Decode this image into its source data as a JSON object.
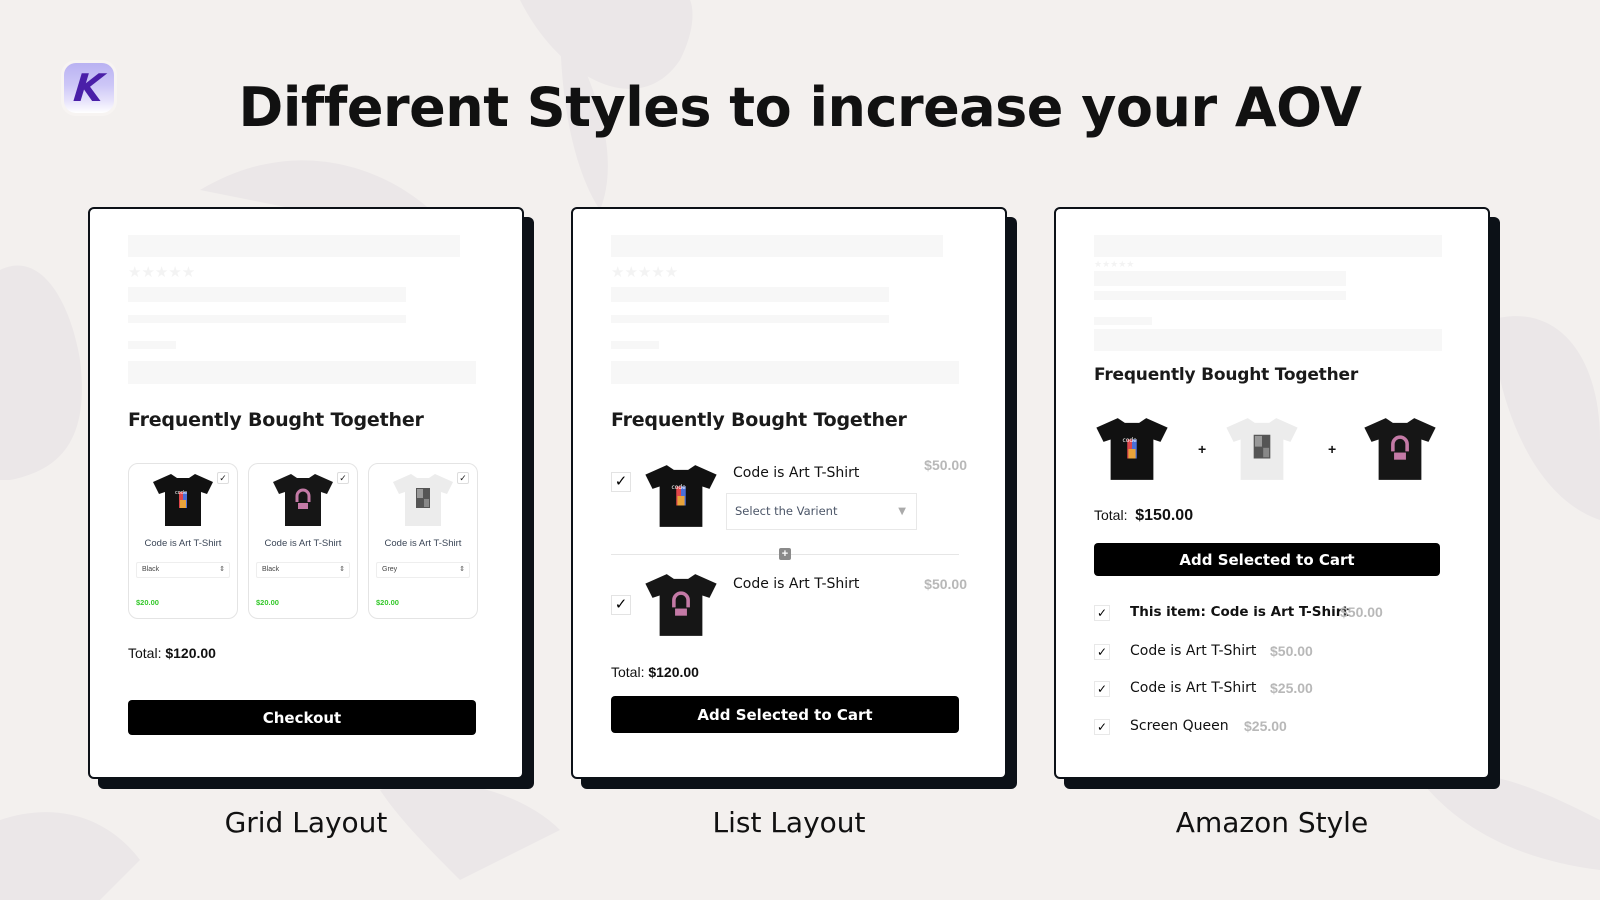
{
  "headline": "Different Styles to increase your AOV",
  "logo": {
    "letter": "K",
    "icon": "brand-logo-icon"
  },
  "colors": {
    "background": "#f3f0ee",
    "card_shadow": "#0c1117",
    "price_green": "#35c82b",
    "price_grey": "#b8b8b8",
    "logo_purple": "#4a1fa8"
  },
  "panels": {
    "grid": {
      "caption": "Grid Layout",
      "fbt_title": "Frequently Bought Together",
      "products": [
        {
          "name": "Code is Art T-Shirt",
          "variant": "Black",
          "price": "$20.00",
          "checked": true,
          "image": "black-code-art-shirt"
        },
        {
          "name": "Code is Art T-Shirt",
          "variant": "Black",
          "price": "$20.00",
          "checked": true,
          "image": "black-rainbow-shirt"
        },
        {
          "name": "Code is Art T-Shirt",
          "variant": "Grey",
          "price": "$20.00",
          "checked": true,
          "image": "white-photo-shirt"
        }
      ],
      "total_label": "Total:",
      "total_value": "$120.00",
      "button_label": "Checkout"
    },
    "list": {
      "caption": "List Layout",
      "fbt_title": "Frequently Bought Together",
      "products": [
        {
          "name": "Code is Art T-Shirt",
          "price": "$50.00",
          "checked": true,
          "variant_placeholder": "Select the Varient",
          "image": "black-code-art-shirt"
        },
        {
          "name": "Code is Art T-Shirt",
          "price": "$50.00",
          "checked": true,
          "image": "black-rainbow-shirt"
        }
      ],
      "total_label": "Total:",
      "total_value": "$120.00",
      "button_label": "Add Selected  to Cart"
    },
    "amazon": {
      "caption": "Amazon Style",
      "fbt_title": "Frequently Bought Together",
      "images": [
        "black-code-art-shirt",
        "white-photo-shirt",
        "black-rainbow-shirt"
      ],
      "plus": "+",
      "total_label": "Total:",
      "total_value": "$150.00",
      "button_label": "Add Selected to Cart",
      "items": [
        {
          "name": "This item: Code is Art T-Shirt",
          "price": "$50.00",
          "checked": true,
          "bold": true
        },
        {
          "name": "Code is Art T-Shirt",
          "price": "$50.00",
          "checked": true
        },
        {
          "name": "Code is Art T-Shirt",
          "price": "$25.00",
          "checked": true
        },
        {
          "name": "Screen Queen",
          "price": "$25.00",
          "checked": true
        }
      ]
    }
  },
  "check_glyph": "✓"
}
